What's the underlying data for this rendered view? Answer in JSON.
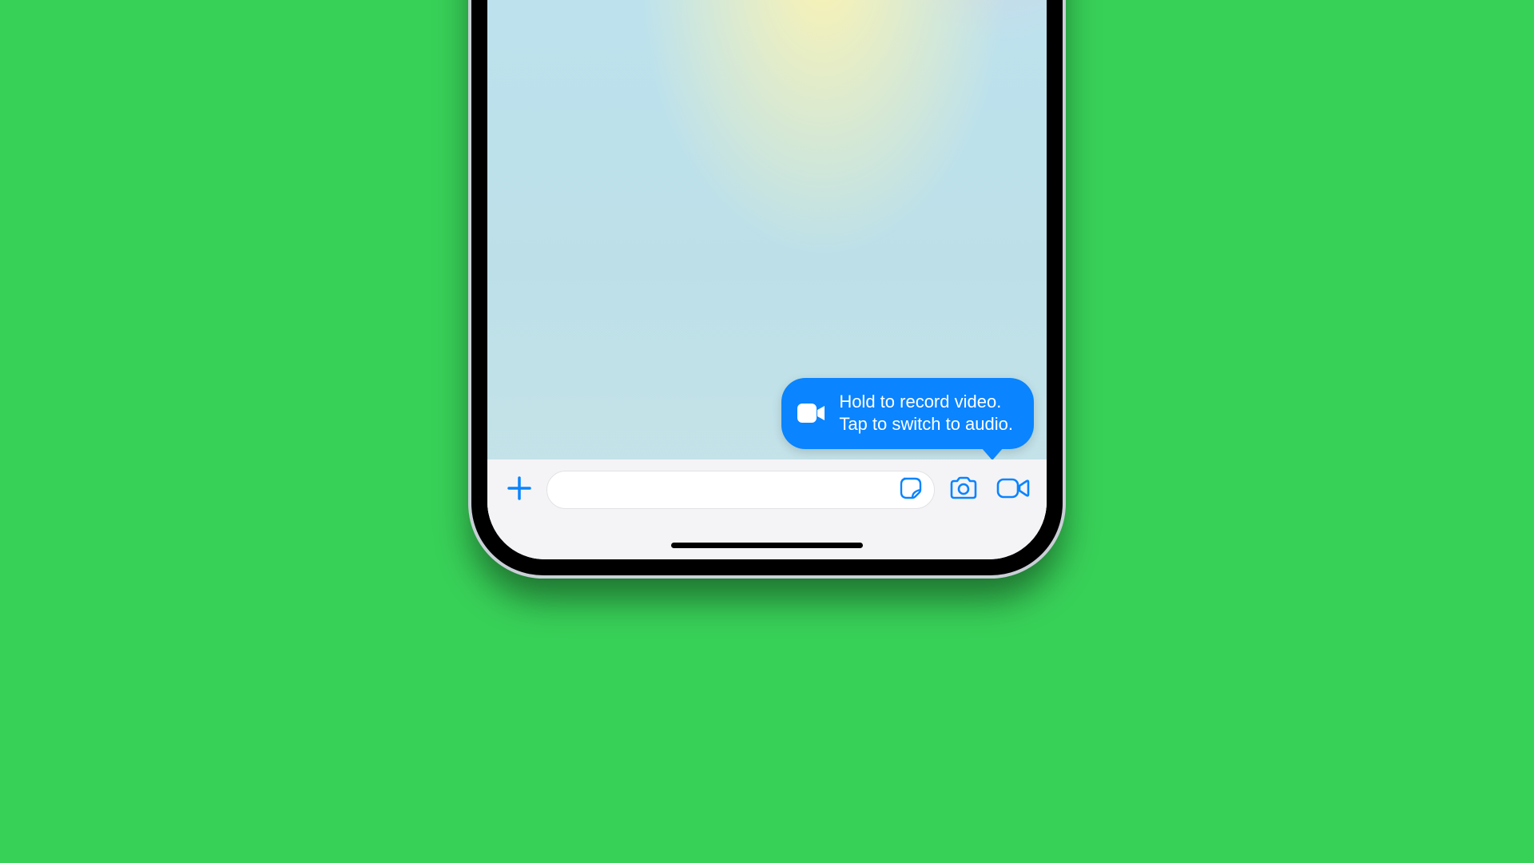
{
  "tooltip": {
    "line1": "Hold to record video.",
    "line2": "Tap to switch to audio."
  },
  "inputbar": {
    "placeholder": ""
  },
  "icons": {
    "plus": "plus-icon",
    "sticker": "sticker-icon",
    "camera": "camera-icon",
    "video": "video-icon",
    "tooltip_video": "video-icon"
  },
  "colors": {
    "accent": "#0a84ff",
    "background": "#38d158"
  }
}
